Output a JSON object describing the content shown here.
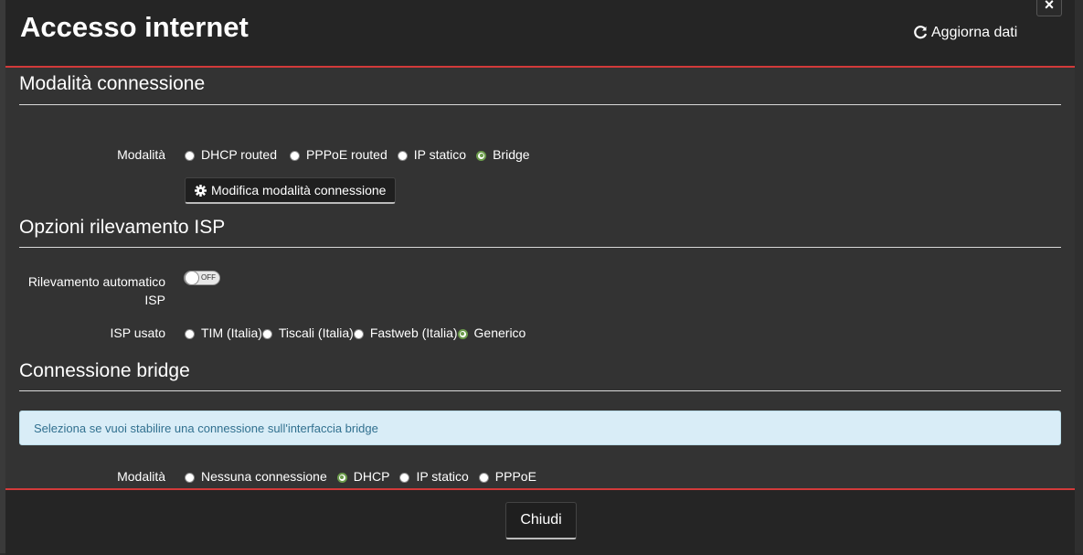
{
  "header": {
    "title": "Accesso internet",
    "refresh_label": "Aggiorna dati",
    "close_label": "×"
  },
  "sections": {
    "connection_mode": {
      "title": "Modalità connessione",
      "mode_label": "Modalità",
      "options": [
        "DHCP routed",
        "PPPoE routed",
        "IP statico",
        "Bridge"
      ],
      "selected": "Bridge",
      "button_label": "Modifica modalità connessione"
    },
    "isp_detection": {
      "title": "Opzioni rilevamento ISP",
      "auto_label": "Rilevamento automatico ISP",
      "toggle_text": "OFF",
      "toggle_on": false,
      "isp_label": "ISP usato",
      "isp_options": [
        "TIM (Italia)",
        "Tiscali (Italia)",
        "Fastweb (Italia)",
        "Generico"
      ],
      "selected": "Generico"
    },
    "bridge": {
      "title": "Connessione bridge",
      "info": "Seleziona se vuoi stabilire una connessione sull'interfaccia bridge",
      "mode_label": "Modalità",
      "options": [
        "Nessuna connessione",
        "DHCP",
        "IP statico",
        "PPPoE"
      ],
      "selected": "DHCP"
    }
  },
  "footer": {
    "close_button": "Chiudi"
  },
  "icons": {
    "refresh": "refresh-icon",
    "gear": "gear-icon"
  },
  "colors": {
    "accent_red": "#d23a3a",
    "radio_checked": "#6a9a4a",
    "info_bg": "#d9edf7",
    "info_text": "#31708f"
  }
}
